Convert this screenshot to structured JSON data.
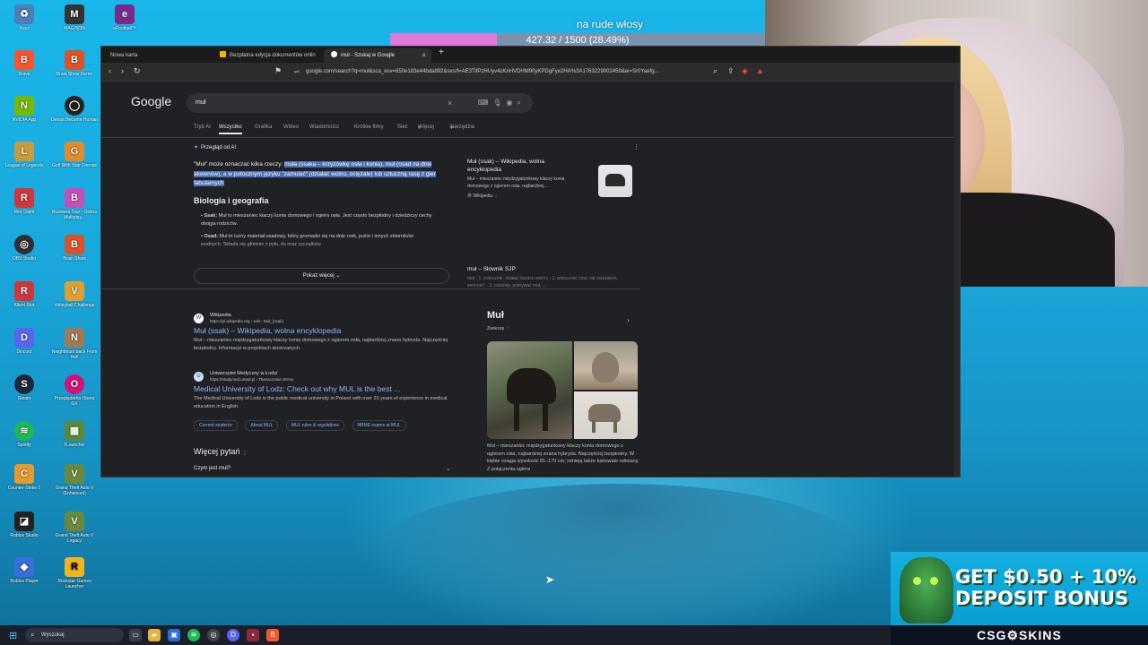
{
  "desktop": {
    "icons": [
      {
        "label": "Kosz",
        "icon": "recycle-bin-icon",
        "color": "#4a7fb8"
      },
      {
        "label": "MAGISON",
        "icon": "app-icon",
        "color": "#333"
      },
      {
        "label": "eFootball™",
        "icon": "game-icon",
        "color": "#7a2a8a"
      },
      {
        "label": "Brave",
        "icon": "brave-icon",
        "color": "#fb542b"
      },
      {
        "label": "Brain Show Demo",
        "icon": "game-icon",
        "color": "#d9542b"
      },
      {
        "label": "NVIDIA App",
        "icon": "nvidia-icon",
        "color": "#76b900"
      },
      {
        "label": "Detroit Become Human",
        "icon": "game-icon",
        "color": "#222"
      },
      {
        "label": "League of Legends",
        "icon": "lol-icon",
        "color": "#c89b3c"
      },
      {
        "label": "Golf With Your Friends",
        "icon": "game-icon",
        "color": "#e28b2b"
      },
      {
        "label": "Riot Client",
        "icon": "riot-icon",
        "color": "#d13639"
      },
      {
        "label": "Business Tour - Online Multiplay...",
        "icon": "game-icon",
        "color": "#c44fb8"
      },
      {
        "label": "OBS Studio",
        "icon": "obs-icon",
        "color": "#302e31"
      },
      {
        "label": "Brain Show",
        "icon": "game-icon",
        "color": "#d9542b"
      },
      {
        "label": "Klient Riot",
        "icon": "riot-icon",
        "color": "#d13639"
      },
      {
        "label": "Volleyball Challenge",
        "icon": "game-icon",
        "color": "#e0a030"
      },
      {
        "label": "Discord",
        "icon": "discord-icon",
        "color": "#5865f2"
      },
      {
        "label": "Neighbours back From Hell",
        "icon": "game-icon",
        "color": "#a07a50"
      },
      {
        "label": "Steam",
        "icon": "steam-icon",
        "color": "#1b2838"
      },
      {
        "label": "Przeglądarka Opera GX",
        "icon": "opera-icon",
        "color": "#d4117a"
      },
      {
        "label": "Spotify",
        "icon": "spotify-icon",
        "color": "#1db954"
      },
      {
        "label": "TLauncher",
        "icon": "minecraft-icon",
        "color": "#5a8a3a"
      },
      {
        "label": "Counter-Strike 2",
        "icon": "cs2-icon",
        "color": "#e89a2a"
      },
      {
        "label": "Grand Theft Auto V (Enhanced)",
        "icon": "gta-icon",
        "color": "#6a8a3a"
      },
      {
        "label": "Roblox Studio",
        "icon": "roblox-studio-icon",
        "color": "#222"
      },
      {
        "label": "Grand Theft Auto V Legacy",
        "icon": "gta-icon",
        "color": "#6a8a3a"
      },
      {
        "label": "Roblox Player",
        "icon": "roblox-icon",
        "color": "#3a6ed8"
      },
      {
        "label": "Rockstar Games Launcher",
        "icon": "rockstar-icon",
        "color": "#f1b51c"
      }
    ]
  },
  "overlay": {
    "goal_title": "na rude włosy",
    "goal_text": "427.32 / 1500 (28.49%)",
    "goal_fraction": 0.2849
  },
  "browser": {
    "tabs": [
      {
        "label": "Nowa karta",
        "icon": "new-tab-icon"
      },
      {
        "label": "Bezpłatna edycja dokumentów onlin",
        "icon": "docs-icon"
      },
      {
        "label": "muł - Szukaj w Google",
        "icon": "google-icon"
      }
    ],
    "url": "google.com/search?q=muł&sca_esv=650e183e44bda892&sxsrf=AE3TifPzHUyv4cKnHVDHM90yKPDgFye2HA%3A1763229002459&ei=Sr0Yaefg..."
  },
  "google": {
    "logo": "Google",
    "query": "muł",
    "nav": [
      "Tryb AI",
      "Wszystko",
      "Grafika",
      "Wideo",
      "Wiadomości",
      "Krótkie filmy",
      "Sieć",
      "Więcej",
      "Narzędzia"
    ],
    "ai_overview": {
      "header": "Przegląd od AI",
      "intro_plain": "\"Muł\" może oznaczać kilka rzeczy: ",
      "intro_highlight": "muła (ssaka – krzyżówkę osła i konia), muł (osad na dnie akwenów), a w potocznym języku \"zamulać\" (działać wolno, ociężale) lub sztuczną rasę z gier fabularnych",
      "heading": "Biologia i geografia",
      "bullet1_label": "Ssak:",
      "bullet1_text": "Muł to mieszaniec klaczy konia domowego i ogiera osła. Jest często bezpłodny i dziedziczy cechy obojga rodziców.",
      "bullet2_label": "Osad:",
      "bullet2_text": "Muł to luźny materiał osadowy, który gromadzi się na dnie rzek, jezior i innych zbiorników wodnych. Składa się głównie z pyłu, iłu oraz szczątków",
      "show_more": "Pokaż więcej",
      "source1_title": "Muł (ssak) – Wikipedia, wolna encyklopedia",
      "source1_desc": "Muł – mieszaniec międzygatunkowy klaczy konia domowego z ogierem osła, najbardziej...",
      "source1_site": "Wikipedia",
      "source2_title": "muł – Słownik SJP",
      "source2_desc": "muł - 1. potocznie: działać bardzo wolno; - 2. potocznie: czuć się ociężałym, senność; - 3. ociężały, pokrywać muł, ..."
    },
    "results": [
      {
        "site": "Wikipedia",
        "url": "https://pl.wikipedia.org › wiki › Muł_(ssak)",
        "title": "Muł (ssak) – Wikipedia, wolna encyklopedia",
        "snippet": "Muł – mieszaniec międzygatunkowy klaczy konia domowego z ogierem osła, najbardziej znana hybryda. Najczęściej bezpłodny. Informacje w projektach siostrzanych."
      },
      {
        "site": "Uniwersytet Medyczny w Łodzi",
        "url": "https://studymed.umed.pl › Tłumaczenie strony",
        "title": "Medical University of Lodz: Check out why MUL is the best ...",
        "snippet": "The Medical University of Lodz is the public medical university in Poland with over 20 years of experience in medical education in English.",
        "chips": [
          "Current students",
          "About MUL",
          "MUL rules & regulations",
          "NBME exams at MUL"
        ]
      }
    ],
    "more_questions": "Więcej pytań",
    "question1": "Czym jest muł?",
    "knowledge_panel": {
      "title": "Muł",
      "subtitle": "Zwierzę",
      "description": "Muł – mieszaniec międzygatunkowy klaczy konia domowego z ogierem osła, najbardziej znana hybryda. Najczęściej bezpłodny. W kłębie osiąga wysokość 81–173 cm; istnieją także karłowate odmiany. Z połączenia ogiera"
    }
  },
  "taskbar": {
    "search_placeholder": "Wyszukaj"
  },
  "ad": {
    "line1": "GET $0.50 + 10%",
    "line2": "DEPOSIT BONUS",
    "brand": "CSG⚙SKINS"
  }
}
